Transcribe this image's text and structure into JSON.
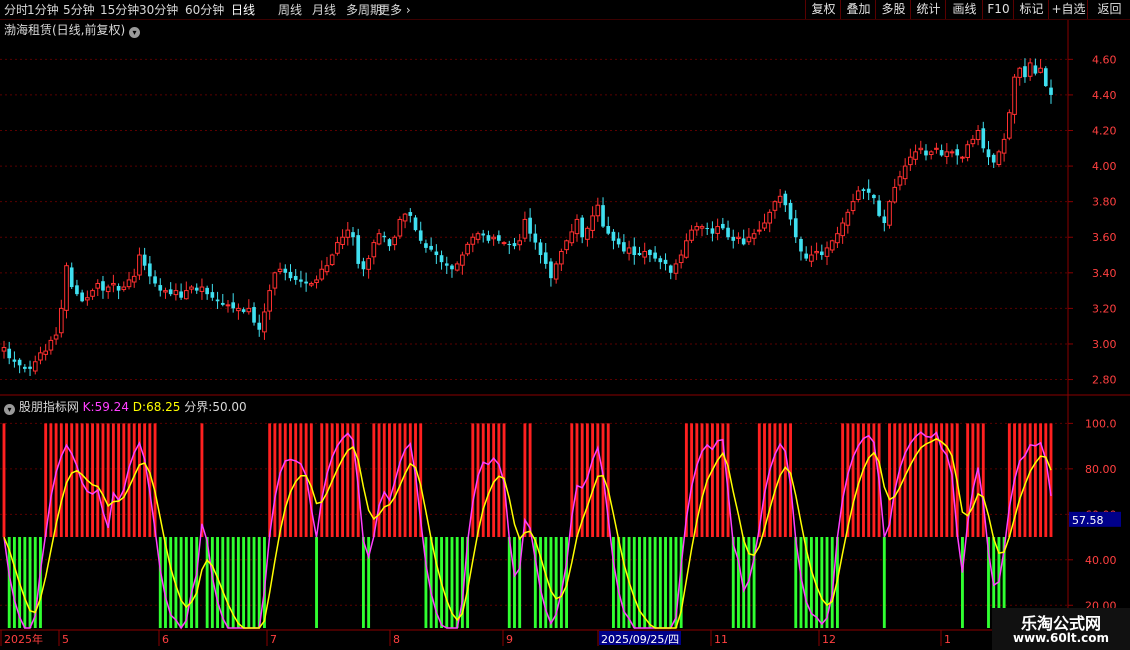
{
  "toolbar": {
    "periods": [
      "分时",
      "1分钟",
      "5分钟",
      "15分钟",
      "30分钟",
      "60分钟",
      "日线",
      "周线",
      "月线",
      "多周期",
      "更多"
    ],
    "active_period": "日线",
    "buttons": [
      "复权",
      "叠加",
      "多股",
      "统计",
      "画线",
      "F10",
      "标记",
      "+自选",
      "返回"
    ]
  },
  "main_chart": {
    "title": "渤海租赁(日线,前复权)",
    "y_ticks": [
      "4.60",
      "4.40",
      "4.20",
      "4.00",
      "3.80",
      "3.60",
      "3.40",
      "3.20",
      "3.00",
      "2.80"
    ],
    "y_values": [
      4.6,
      4.4,
      4.2,
      4.0,
      3.8,
      3.6,
      3.4,
      3.2,
      3.0,
      2.8
    ],
    "up_color": "#ff3030",
    "down_color": "#40e0f0"
  },
  "indicator": {
    "name": "股朋指标网",
    "k_label": "K:",
    "k_value": "59.24",
    "d_label": "D:",
    "d_value": "68.25",
    "boundary_label": "分界:",
    "boundary_value": "50.00",
    "y_ticks": [
      "100.0",
      "80.00",
      "60.00",
      "40.00",
      "20.00"
    ],
    "y_values": [
      100,
      80,
      60,
      40,
      20
    ],
    "current_value_tag": "57.58",
    "k_color": "#ff40ff",
    "d_color": "#ffff00"
  },
  "x_axis": {
    "labels": [
      "2025年",
      "5",
      "6",
      "7",
      "8",
      "9",
      "2025/09/25/四",
      "11",
      "12",
      "1"
    ],
    "cursor_label": "2025/09/25/四"
  },
  "watermark": {
    "line1": "乐淘公式网",
    "line2": "www.60lt.com"
  },
  "chart_data": [
    {
      "type": "candlestick",
      "title": "渤海租赁(日线,前复权)",
      "y_range": [
        2.73,
        4.72
      ],
      "note_series": "approximate daily closes read from the chart",
      "closes": [
        2.98,
        2.92,
        2.9,
        2.88,
        2.86,
        2.86,
        2.9,
        2.95,
        2.96,
        3.02,
        3.05,
        3.2,
        3.44,
        3.32,
        3.28,
        3.24,
        3.26,
        3.3,
        3.34,
        3.3,
        3.32,
        3.34,
        3.3,
        3.32,
        3.36,
        3.38,
        3.5,
        3.44,
        3.38,
        3.34,
        3.3,
        3.3,
        3.28,
        3.3,
        3.26,
        3.3,
        3.32,
        3.3,
        3.32,
        3.28,
        3.26,
        3.24,
        3.22,
        3.22,
        3.2,
        3.2,
        3.18,
        3.2,
        3.12,
        3.08,
        3.18,
        3.3,
        3.4,
        3.42,
        3.4,
        3.37,
        3.36,
        3.35,
        3.34,
        3.34,
        3.36,
        3.42,
        3.44,
        3.5,
        3.57,
        3.6,
        3.64,
        3.6,
        3.45,
        3.42,
        3.48,
        3.57,
        3.62,
        3.6,
        3.55,
        3.6,
        3.7,
        3.73,
        3.72,
        3.64,
        3.58,
        3.54,
        3.53,
        3.5,
        3.46,
        3.44,
        3.42,
        3.45,
        3.5,
        3.56,
        3.6,
        3.62,
        3.61,
        3.58,
        3.6,
        3.58,
        3.57,
        3.56,
        3.55,
        3.58,
        3.7,
        3.62,
        3.57,
        3.5,
        3.45,
        3.37,
        3.45,
        3.52,
        3.58,
        3.63,
        3.7,
        3.6,
        3.65,
        3.72,
        3.78,
        3.66,
        3.62,
        3.58,
        3.56,
        3.52,
        3.54,
        3.5,
        3.5,
        3.52,
        3.5,
        3.48,
        3.46,
        3.45,
        3.4,
        3.45,
        3.5,
        3.58,
        3.64,
        3.66,
        3.66,
        3.65,
        3.62,
        3.66,
        3.65,
        3.6,
        3.58,
        3.6,
        3.56,
        3.6,
        3.62,
        3.64,
        3.68,
        3.74,
        3.8,
        3.83,
        3.78,
        3.7,
        3.6,
        3.52,
        3.48,
        3.5,
        3.52,
        3.5,
        3.54,
        3.58,
        3.62,
        3.68,
        3.74,
        3.8,
        3.86,
        3.86,
        3.85,
        3.82,
        3.72,
        3.68,
        3.8,
        3.88,
        3.94,
        4.0,
        4.05,
        4.08,
        4.1,
        4.06,
        4.08,
        4.1,
        4.06,
        4.08,
        4.08,
        4.06,
        4.05,
        4.12,
        4.15,
        4.2,
        4.1,
        4.05,
        4.02,
        4.08,
        4.15,
        4.3,
        4.5,
        4.55,
        4.5,
        4.58,
        4.52,
        4.55,
        4.45,
        4.4
      ]
    },
    {
      "type": "line",
      "title": "股朋指标网",
      "ylim": [
        10,
        105
      ],
      "threshold": 50,
      "series": [
        {
          "name": "K",
          "last": 59.24
        },
        {
          "name": "D",
          "last": 68.25
        }
      ],
      "note_bars": "red bars where K above 50, green bars where K below 50"
    }
  ]
}
